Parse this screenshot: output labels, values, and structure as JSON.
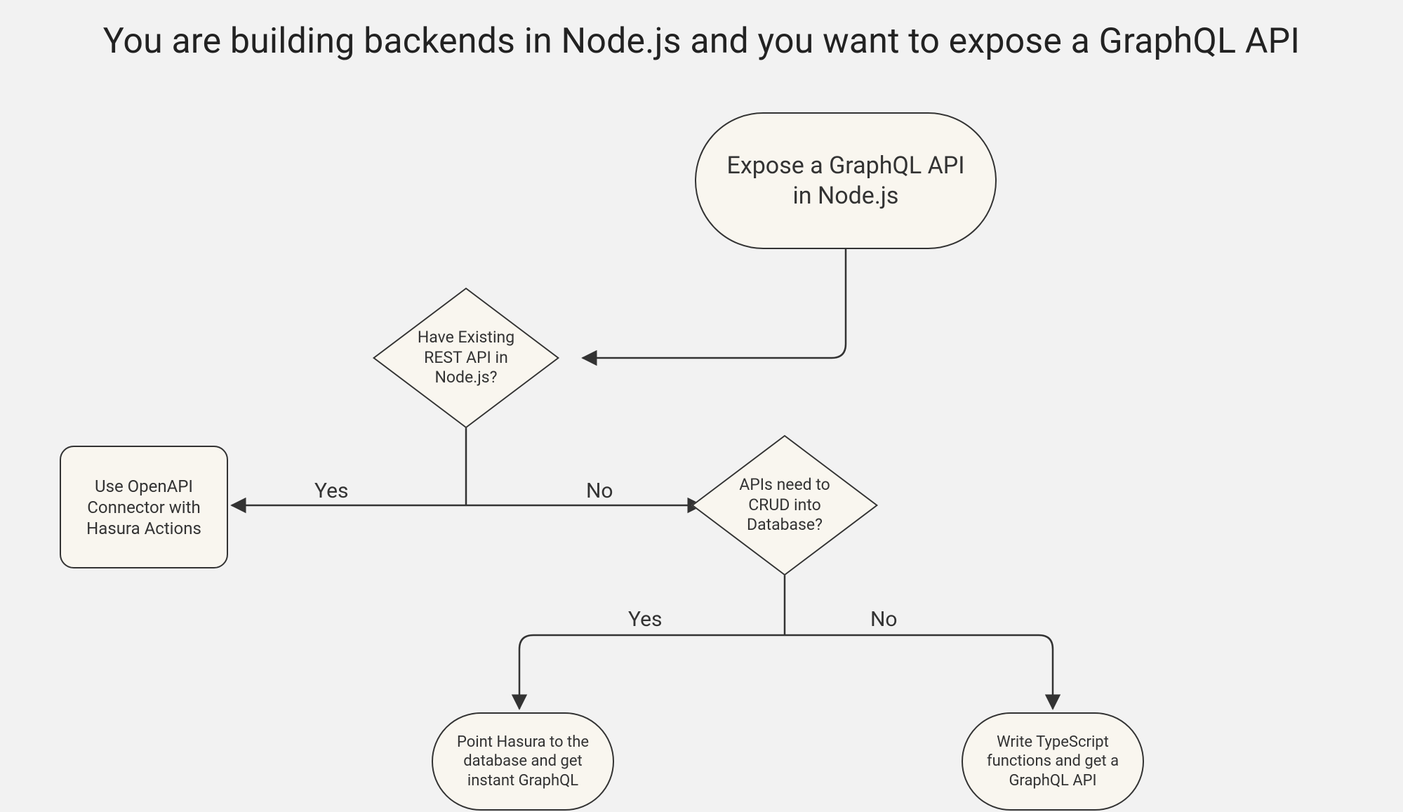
{
  "title": "You are building backends in Node.js and you want to expose a GraphQL API",
  "nodes": {
    "start": {
      "line1": "Expose a GraphQL API",
      "line2": "in Node.js"
    },
    "decision_rest": {
      "line1": "Have Existing",
      "line2": "REST API in",
      "line3": "Node.js?"
    },
    "use_openapi": {
      "line1": "Use OpenAPI",
      "line2": "Connector with",
      "line3": "Hasura Actions"
    },
    "decision_crud": {
      "line1": "APIs need to",
      "line2": "CRUD into",
      "line3": "Database?"
    },
    "point_hasura": {
      "line1": "Point Hasura to the",
      "line2": "database and get",
      "line3": "instant GraphQL"
    },
    "write_ts": {
      "line1": "Write TypeScript",
      "line2": "functions and get a",
      "line3": "GraphQL API"
    }
  },
  "edge_labels": {
    "rest_yes": "Yes",
    "rest_no": "No",
    "crud_yes": "Yes",
    "crud_no": "No"
  },
  "colors": {
    "bg": "#f2f2f2",
    "node_fill": "#f9f6ef",
    "stroke": "#333333"
  }
}
